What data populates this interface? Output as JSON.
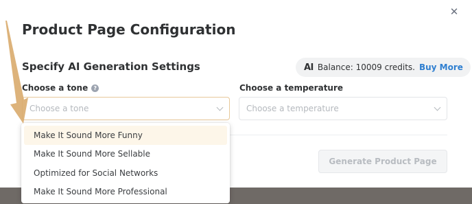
{
  "modal": {
    "title": "Product Page Configuration",
    "close_icon": "close-icon",
    "subtitle": "Specify AI Generation Settings"
  },
  "balance": {
    "ai_label": "AI",
    "text": "Balance: 10009 credits.",
    "buy_more": "Buy More"
  },
  "tone": {
    "label": "Choose a tone",
    "help_icon": "help-icon",
    "placeholder": "Choose a tone",
    "options": [
      "Make It Sound More Funny",
      "Make It Sound More Sellable",
      "Optimized for Social Networks",
      "Make It Sound More Professional"
    ],
    "highlighted_index": 0
  },
  "temperature": {
    "label": "Choose a temperature",
    "placeholder": "Choose a temperature"
  },
  "actions": {
    "generate_label": "Generate Product Page",
    "generate_disabled": true
  },
  "colors": {
    "accent": "#2f7fd0",
    "annotation_arrow": "#d9ab6d",
    "focus_border": "#e8c89a",
    "option_highlight": "#fdf6e9"
  }
}
